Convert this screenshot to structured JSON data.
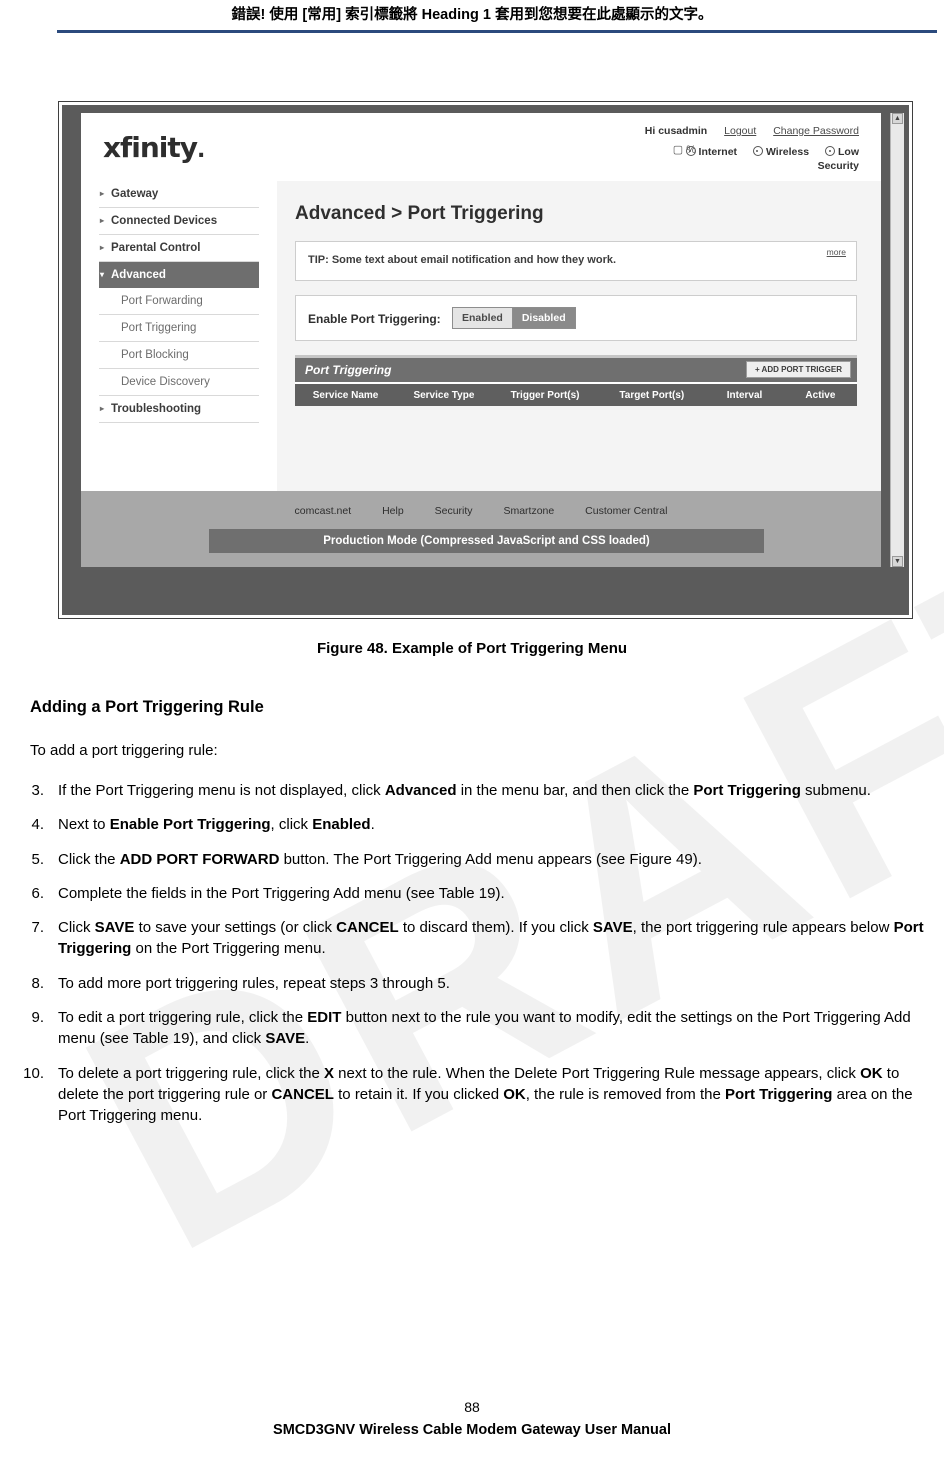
{
  "header": {
    "text": "錯誤! 使用 [常用] 索引標籤將 Heading 1 套用到您想要在此處顯示的文字。"
  },
  "watermark": {
    "text": "DRAFT"
  },
  "screenshot": {
    "logo": "xfinity",
    "logo_dot": ".",
    "account": {
      "greeting": "Hi cusadmin",
      "logout": "Logout",
      "change_password": "Change Password"
    },
    "status": {
      "battery_icon": "battery-icon",
      "battery_label": "%",
      "internet": "Internet",
      "wireless": "Wireless",
      "security": "Low",
      "security_2": "Security"
    },
    "sidebar": {
      "items": [
        {
          "label": "Gateway",
          "caret": "▸",
          "active": false
        },
        {
          "label": "Connected Devices",
          "caret": "▸",
          "active": false
        },
        {
          "label": "Parental Control",
          "caret": "▸",
          "active": false
        },
        {
          "label": "Advanced",
          "caret": "▾",
          "active": true
        }
      ],
      "subitems": [
        "Port Forwarding",
        "Port Triggering",
        "Port Blocking",
        "Device Discovery"
      ],
      "last_item": {
        "label": "Troubleshooting",
        "caret": "▸"
      }
    },
    "main": {
      "title": "Advanced > Port Triggering",
      "tip": {
        "text": "TIP: Some text about email notification and how they work.",
        "more": "more"
      },
      "enable": {
        "label": "Enable Port Triggering:",
        "option_on": "Enabled",
        "option_off": "Disabled",
        "selected": "Disabled"
      },
      "table": {
        "title": "Port Triggering",
        "add_button": "+ ADD PORT TRIGGER",
        "columns": [
          "Service Name",
          "Service Type",
          "Trigger Port(s)",
          "Target Port(s)",
          "Interval",
          "Active"
        ],
        "rows": []
      }
    },
    "footer": {
      "links": [
        "comcast.net",
        "Help",
        "Security",
        "Smartzone",
        "Customer Central"
      ],
      "production_mode": "Production Mode (Compressed JavaScript and CSS loaded)"
    }
  },
  "caption": "Figure 48. Example of Port Triggering Menu",
  "section_title": "Adding a Port Triggering Rule",
  "lead": "To add a port triggering rule:",
  "steps": [
    {
      "num": "3.",
      "html": "If the Port Triggering menu is not displayed, click <b>Advanced</b> in the menu bar, and then click the <b>Port Triggering</b> submenu."
    },
    {
      "num": "4.",
      "html": "Next to <b>Enable Port Triggering</b>, click <b>Enabled</b>."
    },
    {
      "num": "5.",
      "html": "Click the <b>ADD PORT FORWARD</b> button. The Port Triggering Add menu appears (see Figure 49)."
    },
    {
      "num": "6.",
      "html": "Complete the fields in the Port Triggering Add menu (see Table 19)."
    },
    {
      "num": "7.",
      "html": "Click <b>SAVE</b> to save your settings (or click <b>CANCEL</b> to discard them). If you click <b>SAVE</b>, the port triggering rule appears below <b>Port Triggering</b> on the Port Triggering menu."
    },
    {
      "num": "8.",
      "html": "To add more port triggering rules, repeat steps 3 through 5."
    },
    {
      "num": "9.",
      "html": "To edit a port triggering rule, click the <b>EDIT</b> button next to the rule you want to modify, edit the settings on the Port Triggering Add menu (see Table 19), and click <b>SAVE</b>."
    },
    {
      "num": "10.",
      "html": "To delete a port triggering rule, click the <b>X</b> next to the rule. When the Delete Port Triggering Rule message appears, click <b>OK</b> to delete the port triggering rule or <b>CANCEL</b> to retain it. If you clicked <b>OK</b>, the rule is removed from the <b>Port Triggering</b> area on the Port Triggering menu."
    }
  ],
  "page_number": "88",
  "footer_title": "SMCD3GNV Wireless Cable Modem Gateway User Manual"
}
